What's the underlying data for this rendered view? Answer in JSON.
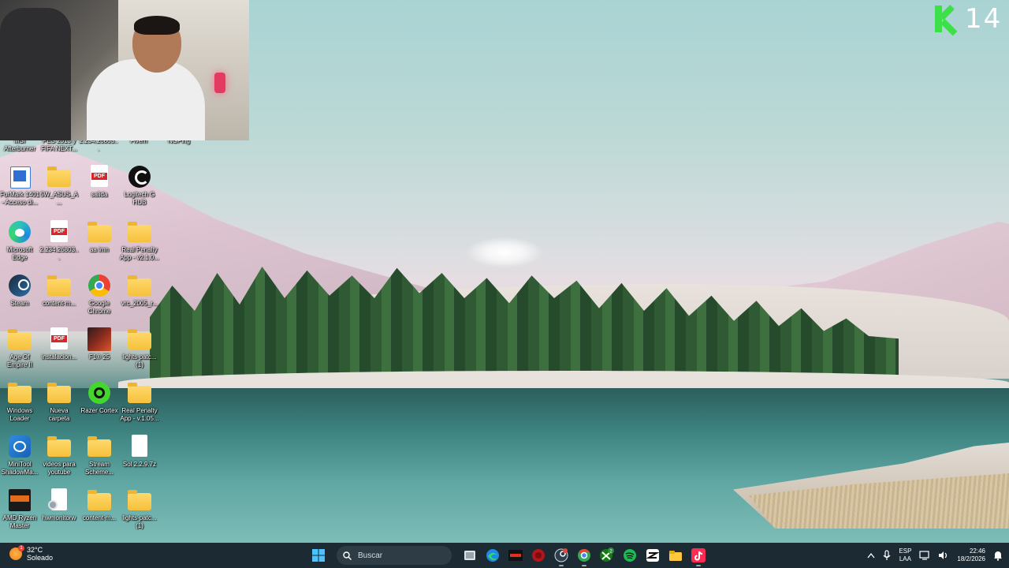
{
  "logo": {
    "text": "14",
    "color": "#3ee04a"
  },
  "desktop": {
    "row0": [
      {
        "label": "MSI Afterburner"
      },
      {
        "label": "PES 2013 y FIFA NEXT..."
      },
      {
        "label": "2.234.26803..."
      },
      {
        "label": "Fivem"
      },
      {
        "label": "NGPing"
      }
    ],
    "icons": [
      {
        "label": "FurMark 1401 - Acceso di...",
        "icon": "furmark-icon"
      },
      {
        "label": "5W_ASUS_A...",
        "icon": "folder-icon"
      },
      {
        "label": "salida",
        "icon": "pdf-icon"
      },
      {
        "label": "Logitech G HUB",
        "icon": "logitech-icon"
      },
      {
        "label": "Microsoft Edge",
        "icon": "edge-icon"
      },
      {
        "label": "2.234.26803...",
        "icon": "pdf-icon"
      },
      {
        "label": "aa imn",
        "icon": "folder-icon"
      },
      {
        "label": "Real Penalty App - v2.1.0...",
        "icon": "folder-icon"
      },
      {
        "label": "Steam",
        "icon": "steam-icon"
      },
      {
        "label": "content-m...",
        "icon": "folder-icon"
      },
      {
        "label": "Google Chrome",
        "icon": "chrome-icon"
      },
      {
        "label": "vrc_2005_r...",
        "icon": "folder-icon"
      },
      {
        "label": "Age Of Empire II",
        "icon": "folder-icon"
      },
      {
        "label": "instalacion...",
        "icon": "pdf-icon"
      },
      {
        "label": "F1® 25",
        "icon": "f1-icon"
      },
      {
        "label": "lights-patc... (1)",
        "icon": "folder-icon"
      },
      {
        "label": "Windows Loader",
        "icon": "folder-icon"
      },
      {
        "label": "Nueva carpeta",
        "icon": "folder-icon"
      },
      {
        "label": "Razer Cortex",
        "icon": "razer-icon"
      },
      {
        "label": "Real Penalty App - v.1.05...",
        "icon": "folder-icon"
      },
      {
        "label": "MiniTool ShadowMa...",
        "icon": "minitool-icon"
      },
      {
        "label": "videos para youtube",
        "icon": "folder-icon"
      },
      {
        "label": "Stream Scheme...",
        "icon": "folder-icon"
      },
      {
        "label": "Sol 2.2.9.7z",
        "icon": "file-icon"
      },
      {
        "label": "AMD Ryzen Master",
        "icon": "ryzen-icon"
      },
      {
        "label": "hwmonitorw",
        "icon": "settings-file-icon"
      },
      {
        "label": "content-m...",
        "icon": "folder-icon"
      },
      {
        "label": "lights-patc... (1)",
        "icon": "folder-icon"
      }
    ]
  },
  "taskbar": {
    "weather": {
      "temp": "32°C",
      "condition": "Soleado",
      "badge": "1"
    },
    "search_placeholder": "Buscar",
    "apps": [
      {
        "name": "task-view"
      },
      {
        "name": "edge"
      },
      {
        "name": "amd"
      },
      {
        "name": "red-app"
      },
      {
        "name": "steam"
      },
      {
        "name": "chrome"
      },
      {
        "name": "xbox"
      },
      {
        "name": "spotify"
      },
      {
        "name": "capcut"
      },
      {
        "name": "file-explorer"
      },
      {
        "name": "tiktok"
      }
    ],
    "xbox_badge": "2",
    "tray": {
      "lang_top": "ESP",
      "lang_bottom": "LAA",
      "time": "22:46",
      "date": "18/2/2026"
    }
  }
}
